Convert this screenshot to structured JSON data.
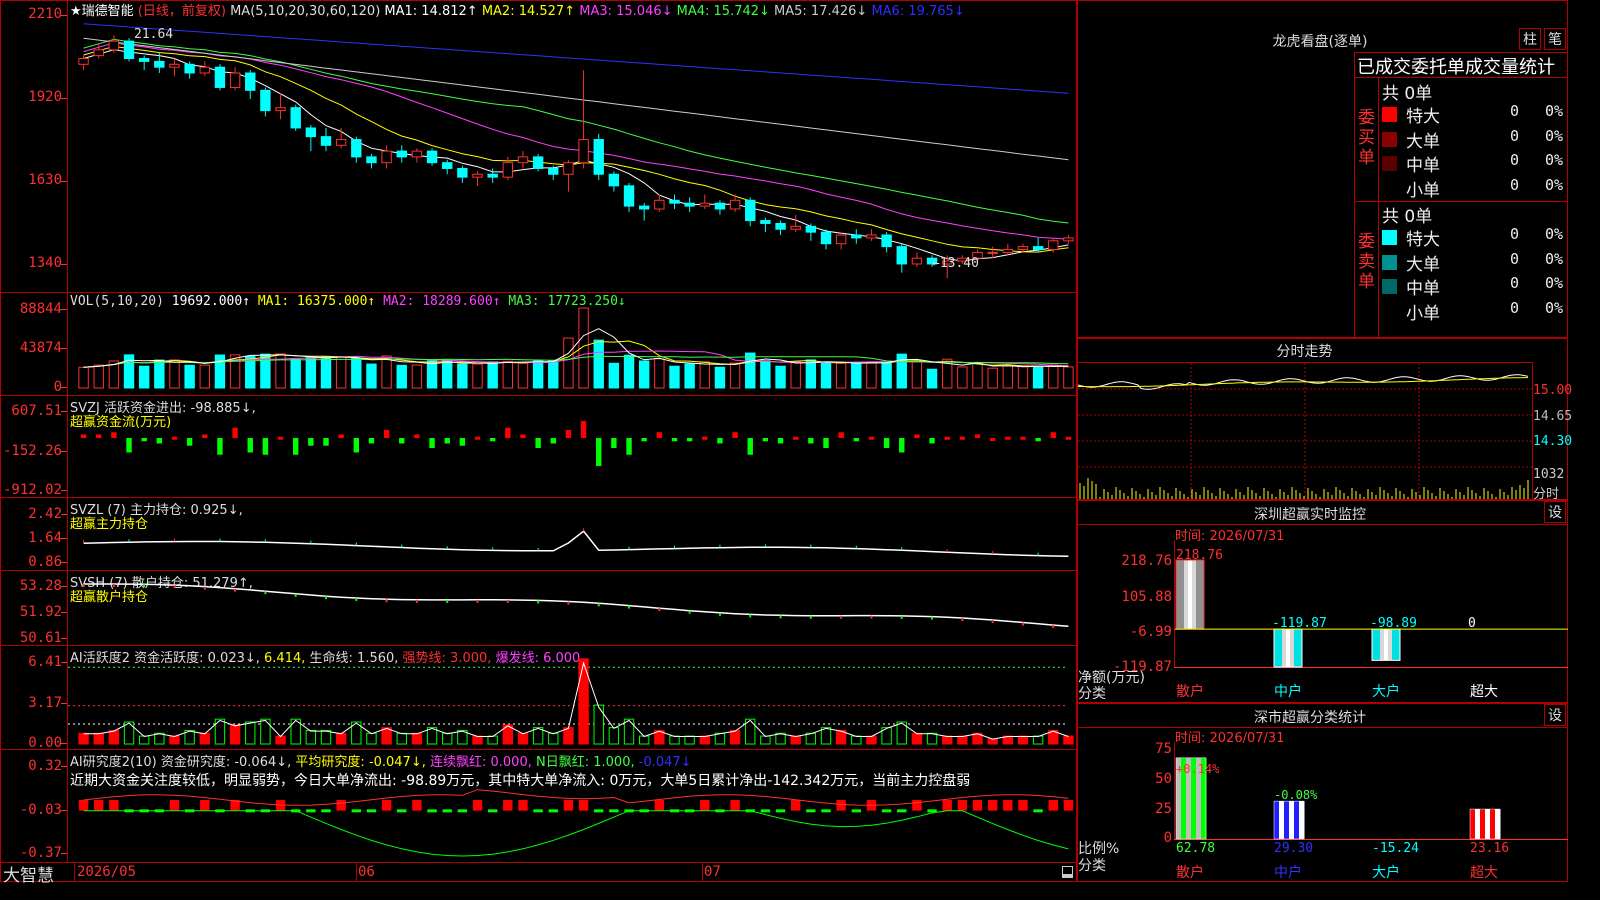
{
  "stock": {
    "name": "★瑞德智能",
    "period": "(日线，前复权)"
  },
  "ma_header": {
    "prefix": "MA(5,10,20,30,60,120)",
    "items": [
      {
        "label": "MA1: 14.812↑",
        "color": "#ffffff"
      },
      {
        "label": "MA2: 14.527↑",
        "color": "#ffff00"
      },
      {
        "label": "MA3: 15.046↓",
        "color": "#ff40ff"
      },
      {
        "label": "MA4: 15.742↓",
        "color": "#40ff40"
      },
      {
        "label": "MA5: 17.426↓",
        "color": "#cccccc"
      },
      {
        "label": "MA6: 19.765↓",
        "color": "#3030ff"
      }
    ]
  },
  "price_axis": [
    "2210",
    "1920",
    "1630",
    "1340"
  ],
  "price_high_label": "21.64",
  "price_low_label": "←13.40",
  "vol": {
    "header": "VOL(5,10,20)",
    "value": "19692.000↑",
    "ma1": "MA1: 16375.000↑",
    "ma2": "MA2: 18289.600↑",
    "ma3": "MA3: 17723.250↓",
    "axis": [
      "88844",
      "43874",
      "0"
    ]
  },
  "svzj": {
    "header": "SVZJ  活跃资金进出: -98.885↓,",
    "subtitle": "超赢资金流(万元)",
    "axis": [
      "607.51",
      "-152.26",
      "-912.02"
    ]
  },
  "svzl": {
    "header": "SVZL (7) 主力持仓: 0.925↓,",
    "subtitle": "超赢主力持仓",
    "axis": [
      "2.42",
      "1.64",
      "0.86"
    ]
  },
  "svsh": {
    "header": "SVSH (7) 散户持仓: 51.279↑,",
    "subtitle": "超赢散户持仓",
    "axis": [
      "53.28",
      "51.92",
      "50.61"
    ]
  },
  "ai1": {
    "header": "AI活跃度2 资金活跃度: 0.023↓,",
    "v2": "6.414,",
    "v3": "生命线: 1.560,",
    "v4": "强势线: 3.000,",
    "v5": "爆发线: 6.000,",
    "axis": [
      "6.41",
      "3.17",
      "0.00"
    ]
  },
  "ai2": {
    "header": "AI研究度2(10) 资金研究度: -0.064↓,",
    "v2": "平均研究度: -0.047↓,",
    "v3": "连续飘红: 0.000,",
    "v4": "N日飘红: 1.000,",
    "v5": "-0.047↓",
    "comment": "近期大资金关注度较低，明显弱势，今日大单净流出: -98.89万元，其中特大单净流入: 0万元，大单5日累计净出-142.342万元，当前主力控盘弱",
    "axis": [
      "0.32",
      "-0.03",
      "-0.37"
    ]
  },
  "bottom": {
    "brand": "大智慧",
    "dates": [
      "2026/05",
      "06",
      "07"
    ]
  },
  "lhb": {
    "title": "龙虎看盘(逐单)",
    "btn1": "柱",
    "btn2": "笔",
    "tabs": "已成交委托单成交量统计",
    "buy": {
      "side": "委买单",
      "total": "共 0单",
      "rows": [
        {
          "label": "特大",
          "count": "0",
          "pct": "0%",
          "color": "#ff0000"
        },
        {
          "label": "大单",
          "count": "0",
          "pct": "0%",
          "color": "#8b0000"
        },
        {
          "label": "中单",
          "count": "0",
          "pct": "0%",
          "color": "#5a0000"
        },
        {
          "label": "小单",
          "count": "0",
          "pct": "0%",
          "color": "#000000"
        }
      ]
    },
    "sell": {
      "side": "委卖单",
      "total": "共 0单",
      "rows": [
        {
          "label": "特大",
          "count": "0",
          "pct": "0%",
          "color": "#00ffff"
        },
        {
          "label": "大单",
          "count": "0",
          "pct": "0%",
          "color": "#009090"
        },
        {
          "label": "中单",
          "count": "0",
          "pct": "0%",
          "color": "#006868"
        },
        {
          "label": "小单",
          "count": "0",
          "pct": "0%",
          "color": "#000000"
        }
      ]
    }
  },
  "fenshi": {
    "title": "分时走势",
    "axis": [
      "15.00",
      "14.65",
      "14.30"
    ],
    "vol_label": "1032",
    "bottom_label": "分时"
  },
  "sz_monitor": {
    "title": "深圳超赢实时监控",
    "btn": "设",
    "time": "时间: 2026/07/31",
    "axis": [
      "218.76",
      "105.88",
      "-6.99",
      "-119.87"
    ],
    "ylabel": "净额(万元)",
    "xlabel": "分类",
    "bars": [
      {
        "cat": "散户",
        "value": 218.76,
        "label": "218.76"
      },
      {
        "cat": "中户",
        "value": -119.87,
        "label": "-119.87"
      },
      {
        "cat": "大户",
        "value": -98.89,
        "label": "-98.89"
      },
      {
        "cat": "超大",
        "value": 0,
        "label": "0"
      }
    ]
  },
  "sz_class": {
    "title": "深市超赢分类统计",
    "btn": "设",
    "time": "时间: 2026/07/31",
    "axis": [
      "75",
      "50",
      "25",
      "0"
    ],
    "ylabel": "比例%",
    "xlabel": "分类",
    "bars": [
      {
        "cat": "散户",
        "value": 62.78,
        "top": "+0.14%",
        "bottom": "62.78"
      },
      {
        "cat": "中户",
        "value": 29.3,
        "top": "-0.08%",
        "bottom": "29.30"
      },
      {
        "cat": "大户",
        "value": 0,
        "top": "",
        "bottom": "-15.24"
      },
      {
        "cat": "超大",
        "value": 23.16,
        "top": "",
        "bottom": "23.16"
      }
    ]
  },
  "chart_data": {
    "type": "candlestick",
    "price_axis": [
      13.4,
      16.3,
      19.2,
      22.1
    ],
    "candles": [
      [
        20.8,
        21.0,
        21.1,
        20.6
      ],
      [
        21.1,
        21.3,
        21.5,
        21.0
      ],
      [
        21.3,
        21.6,
        21.8,
        21.2
      ],
      [
        21.6,
        21.0,
        21.7,
        20.9
      ],
      [
        21.0,
        20.9,
        21.1,
        20.6
      ],
      [
        20.9,
        20.7,
        21.2,
        20.5
      ],
      [
        20.7,
        20.8,
        21.0,
        20.4
      ],
      [
        20.8,
        20.5,
        20.9,
        20.3
      ],
      [
        20.5,
        20.7,
        20.9,
        20.4
      ],
      [
        20.7,
        20.0,
        20.8,
        19.9
      ],
      [
        20.0,
        20.5,
        20.7,
        19.9
      ],
      [
        20.5,
        19.9,
        20.6,
        19.6
      ],
      [
        19.9,
        19.2,
        20.0,
        19.0
      ],
      [
        19.2,
        19.3,
        19.8,
        18.9
      ],
      [
        19.3,
        18.6,
        19.4,
        18.5
      ],
      [
        18.6,
        18.3,
        18.7,
        17.8
      ],
      [
        18.3,
        18.0,
        18.6,
        17.8
      ],
      [
        18.0,
        18.2,
        18.6,
        17.9
      ],
      [
        18.2,
        17.6,
        18.3,
        17.4
      ],
      [
        17.6,
        17.4,
        17.7,
        17.2
      ],
      [
        17.4,
        17.8,
        18.0,
        17.2
      ],
      [
        17.8,
        17.6,
        18.0,
        17.4
      ],
      [
        17.6,
        17.8,
        17.9,
        17.4
      ],
      [
        17.8,
        17.4,
        17.9,
        17.3
      ],
      [
        17.4,
        17.2,
        17.5,
        17.0
      ],
      [
        17.2,
        16.9,
        17.3,
        16.7
      ],
      [
        16.9,
        17.0,
        17.1,
        16.6
      ],
      [
        17.0,
        16.9,
        17.2,
        16.7
      ],
      [
        16.9,
        17.4,
        17.6,
        16.8
      ],
      [
        17.4,
        17.6,
        17.8,
        17.2
      ],
      [
        17.6,
        17.2,
        17.7,
        17.1
      ],
      [
        17.2,
        17.0,
        17.3,
        16.8
      ],
      [
        17.0,
        17.4,
        17.5,
        16.4
      ],
      [
        17.4,
        18.2,
        20.6,
        17.2
      ],
      [
        18.2,
        17.0,
        18.4,
        16.8
      ],
      [
        17.0,
        16.6,
        17.1,
        16.4
      ],
      [
        16.6,
        15.9,
        16.7,
        15.7
      ],
      [
        15.9,
        15.8,
        16.0,
        15.4
      ],
      [
        15.8,
        16.1,
        16.3,
        15.7
      ],
      [
        16.1,
        16.0,
        16.3,
        15.8
      ],
      [
        16.0,
        15.9,
        16.2,
        15.7
      ],
      [
        15.9,
        16.0,
        16.3,
        15.8
      ],
      [
        16.0,
        15.8,
        16.1,
        15.6
      ],
      [
        15.8,
        16.1,
        16.3,
        15.7
      ],
      [
        16.1,
        15.4,
        16.2,
        15.2
      ],
      [
        15.4,
        15.3,
        15.5,
        15.0
      ],
      [
        15.3,
        15.1,
        15.4,
        14.9
      ],
      [
        15.1,
        15.2,
        15.6,
        15.0
      ],
      [
        15.2,
        15.0,
        15.3,
        14.7
      ],
      [
        15.0,
        14.6,
        15.1,
        14.4
      ],
      [
        14.6,
        14.9,
        15.0,
        14.4
      ],
      [
        14.9,
        14.8,
        15.1,
        14.6
      ],
      [
        14.8,
        14.9,
        15.1,
        14.7
      ],
      [
        14.9,
        14.5,
        15.0,
        14.3
      ],
      [
        14.5,
        13.9,
        14.6,
        13.6
      ],
      [
        13.9,
        14.1,
        14.3,
        13.8
      ],
      [
        14.1,
        13.9,
        14.2,
        13.8
      ],
      [
        13.9,
        14.0,
        14.2,
        13.4
      ],
      [
        14.0,
        14.1,
        14.2,
        13.9
      ],
      [
        14.1,
        14.3,
        14.4,
        14.0
      ],
      [
        14.3,
        14.3,
        14.5,
        14.1
      ],
      [
        14.3,
        14.4,
        14.6,
        14.2
      ],
      [
        14.4,
        14.5,
        14.6,
        14.3
      ],
      [
        14.5,
        14.4,
        14.8,
        14.3
      ],
      [
        14.4,
        14.7,
        14.8,
        14.3
      ],
      [
        14.7,
        14.8,
        14.9,
        14.6
      ]
    ],
    "volume_max": 88844,
    "svzj_range": [
      -912.02,
      607.51
    ],
    "svzl_range": [
      0.86,
      2.42
    ],
    "svsh_range": [
      50.61,
      53.28
    ],
    "ai1_range": [
      0,
      6.41
    ],
    "ai2_range": [
      -0.37,
      0.32
    ]
  }
}
